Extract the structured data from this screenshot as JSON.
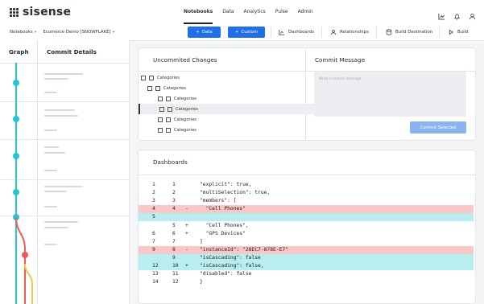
{
  "app": {
    "logo_text": "sisense"
  },
  "nav": [
    "Notebooks",
    "Data",
    "Analytics",
    "Pulse",
    "Admin"
  ],
  "nav_active": "Notebooks",
  "top_icons": [
    "chart-icon",
    "bell-icon",
    "user-icon"
  ],
  "breadcrumb": [
    "Notebooks »",
    "Ecomerce Demo [SNOWFLAKE] »"
  ],
  "toolbar": {
    "data_button": "Data",
    "custom_button": "Custom",
    "dashboards": "Dashboards",
    "relationships": "Relationships",
    "build_destination": "Build Destination",
    "build": "Build"
  },
  "left": {
    "graph_header": "Graph",
    "details_header": "Commit Details"
  },
  "uncommitted": {
    "title": "Uncommited Changes",
    "items": [
      {
        "label": "Categories",
        "level": 0,
        "selected": false
      },
      {
        "label": "Categories",
        "level": 1,
        "selected": false
      },
      {
        "label": "Categories",
        "level": 2,
        "selected": false
      },
      {
        "label": "Categories",
        "level": 2,
        "selected": true
      },
      {
        "label": "Categories",
        "level": 2,
        "selected": false
      },
      {
        "label": "Categories",
        "level": 2,
        "selected": false
      }
    ]
  },
  "commit_message": {
    "title": "Commit Message",
    "placeholder": "Write a commit message...",
    "button": "Commit Selected"
  },
  "dashboards": {
    "title": "Dashboards",
    "diff": [
      {
        "left": "1",
        "right": "1",
        "sign": "",
        "code": "\"explicit\": true,",
        "type": "normal"
      },
      {
        "left": "2",
        "right": "2",
        "sign": "",
        "code": "\"multiSelection\": true,",
        "type": "normal"
      },
      {
        "left": "3",
        "right": "3",
        "sign": "",
        "code": "\"members\": [",
        "type": "normal"
      },
      {
        "left": "4",
        "right": "4",
        "sign": "-",
        "code": "  \"Cell Phones\"",
        "type": "del"
      },
      {
        "left": "5",
        "right": "",
        "sign": "",
        "code": "",
        "type": "add"
      },
      {
        "left": "",
        "right": "5",
        "sign": "+",
        "code": "  \"Cell Phones\",",
        "type": "normal"
      },
      {
        "left": "6",
        "right": "6",
        "sign": "+",
        "code": "  \"GPS Devices\"",
        "type": "normal"
      },
      {
        "left": "7",
        "right": "7",
        "sign": "",
        "code": "]",
        "type": "normal"
      },
      {
        "left": "9",
        "right": "8",
        "sign": "-",
        "code": "\"instanceId\": \"28EC7-878E-E7\"",
        "type": "del"
      },
      {
        "left": "",
        "right": "9",
        "sign": "",
        "code": "\"isCascading\": false",
        "type": "add"
      },
      {
        "left": "12",
        "right": "10",
        "sign": "+",
        "code": "\"isCascading\": false,",
        "type": "add"
      },
      {
        "left": "13",
        "right": "11",
        "sign": "",
        "code": "\"disabled\": false",
        "type": "normal"
      },
      {
        "left": "14",
        "right": "12",
        "sign": "",
        "code": "}",
        "type": "normal"
      }
    ]
  },
  "colors": {
    "accent": "#1f6feb",
    "graph_main": "#22c7d6",
    "graph_branch_red": "#f05a5a",
    "graph_branch_yellow": "#f2c94c",
    "diff_del": "#f9c7c7",
    "diff_add": "#b9eef1"
  }
}
